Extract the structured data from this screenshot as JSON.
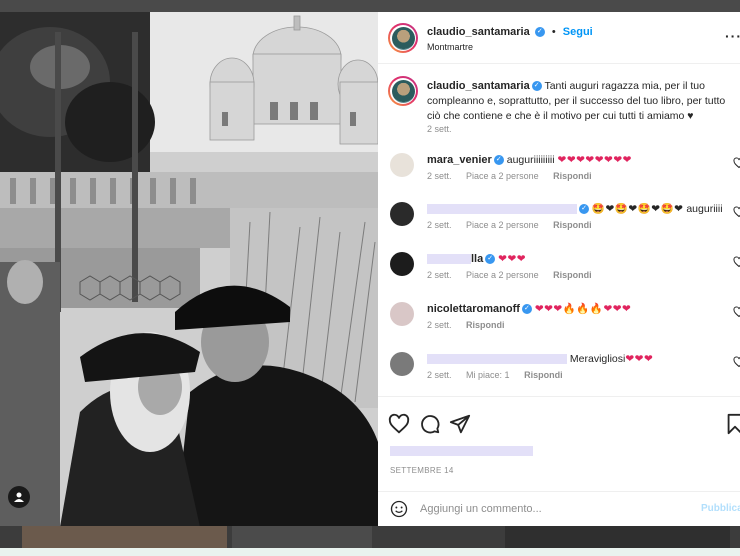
{
  "post": {
    "username": "claudio_santamaria",
    "follow_label": "Segui",
    "dot": "•",
    "location": "Montmartre",
    "more_label": "···",
    "verified_mark": "✓"
  },
  "caption": {
    "username": "claudio_santamaria",
    "text": "Tanti auguri ragazza mia, per il tuo compleanno e, soprattutto, per il successo del tuo libro, per tutto ciò che contiene e che è il motivo per cui tutti ti amiamo ♥",
    "time": "2 sett."
  },
  "comments": [
    {
      "username": "mara_venier",
      "text": "auguriiiiiiiii",
      "emojis": "❤❤❤❤❤❤❤❤",
      "time": "2 sett.",
      "likes": "Piace a 2 persone",
      "reply": "Rispondi",
      "avatar_color": "#e8e2da"
    },
    {
      "username": "",
      "text": "auguriiii",
      "emojis": "🤩❤🤩❤🤩❤🤩❤",
      "time": "2 sett.",
      "likes": "Piace a 2 persone",
      "reply": "Rispondi",
      "avatar_color": "#2a2a2a"
    },
    {
      "username": "lla",
      "text": "",
      "emojis": "❤❤❤",
      "time": "2 sett.",
      "likes": "Piace a 2 persone",
      "reply": "Rispondi",
      "avatar_color": "#1c1c1c"
    },
    {
      "username": "nicolettaromanoff",
      "text": "",
      "emojis": "❤❤❤🔥🔥🔥❤❤❤",
      "time": "2 sett.",
      "likes": "",
      "reply": "Rispondi",
      "avatar_color": "#d9c7c7"
    },
    {
      "username": "",
      "text": "Meravigliosi",
      "emojis": "❤❤❤",
      "time": "2 sett.",
      "likes": "Mi piace: 1",
      "reply": "Rispondi",
      "avatar_color": "#7a7a7a"
    }
  ],
  "footer": {
    "date": "SETTEMBRE 14",
    "comment_placeholder": "Aggiungi un commento...",
    "publish_label": "Pubblica"
  }
}
